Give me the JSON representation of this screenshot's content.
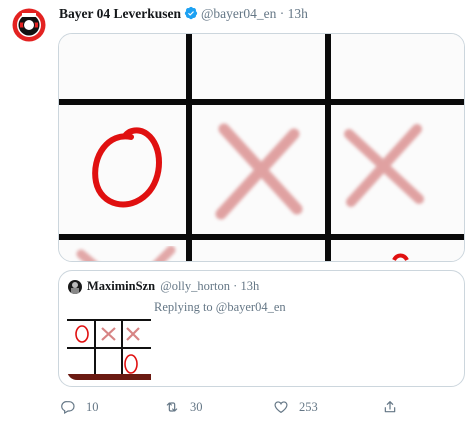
{
  "tweet": {
    "author_name": "Bayer 04 Leverkusen",
    "handle": "@bayer04_en",
    "separator": "·",
    "time": "13h",
    "verified": true
  },
  "quoted_tweet": {
    "author_name": "MaximinSzn",
    "handle": "@olly_horton",
    "separator": "·",
    "time": "13h",
    "replying_to": "Replying to @bayer04_en"
  },
  "actions": {
    "reply_count": "10",
    "retweet_count": "30",
    "like_count": "253"
  },
  "icons": {
    "reply": "reply-icon",
    "retweet": "retweet-icon",
    "like": "heart-icon",
    "share": "share-icon",
    "verified": "verified-badge-icon"
  },
  "colors": {
    "brand_red": "#e32221",
    "verified_blue": "#1da1f2",
    "secondary_text": "#657786",
    "border": "#ccd6dd",
    "o_mark": "#e01010",
    "x_mark": "#d98a8a"
  }
}
